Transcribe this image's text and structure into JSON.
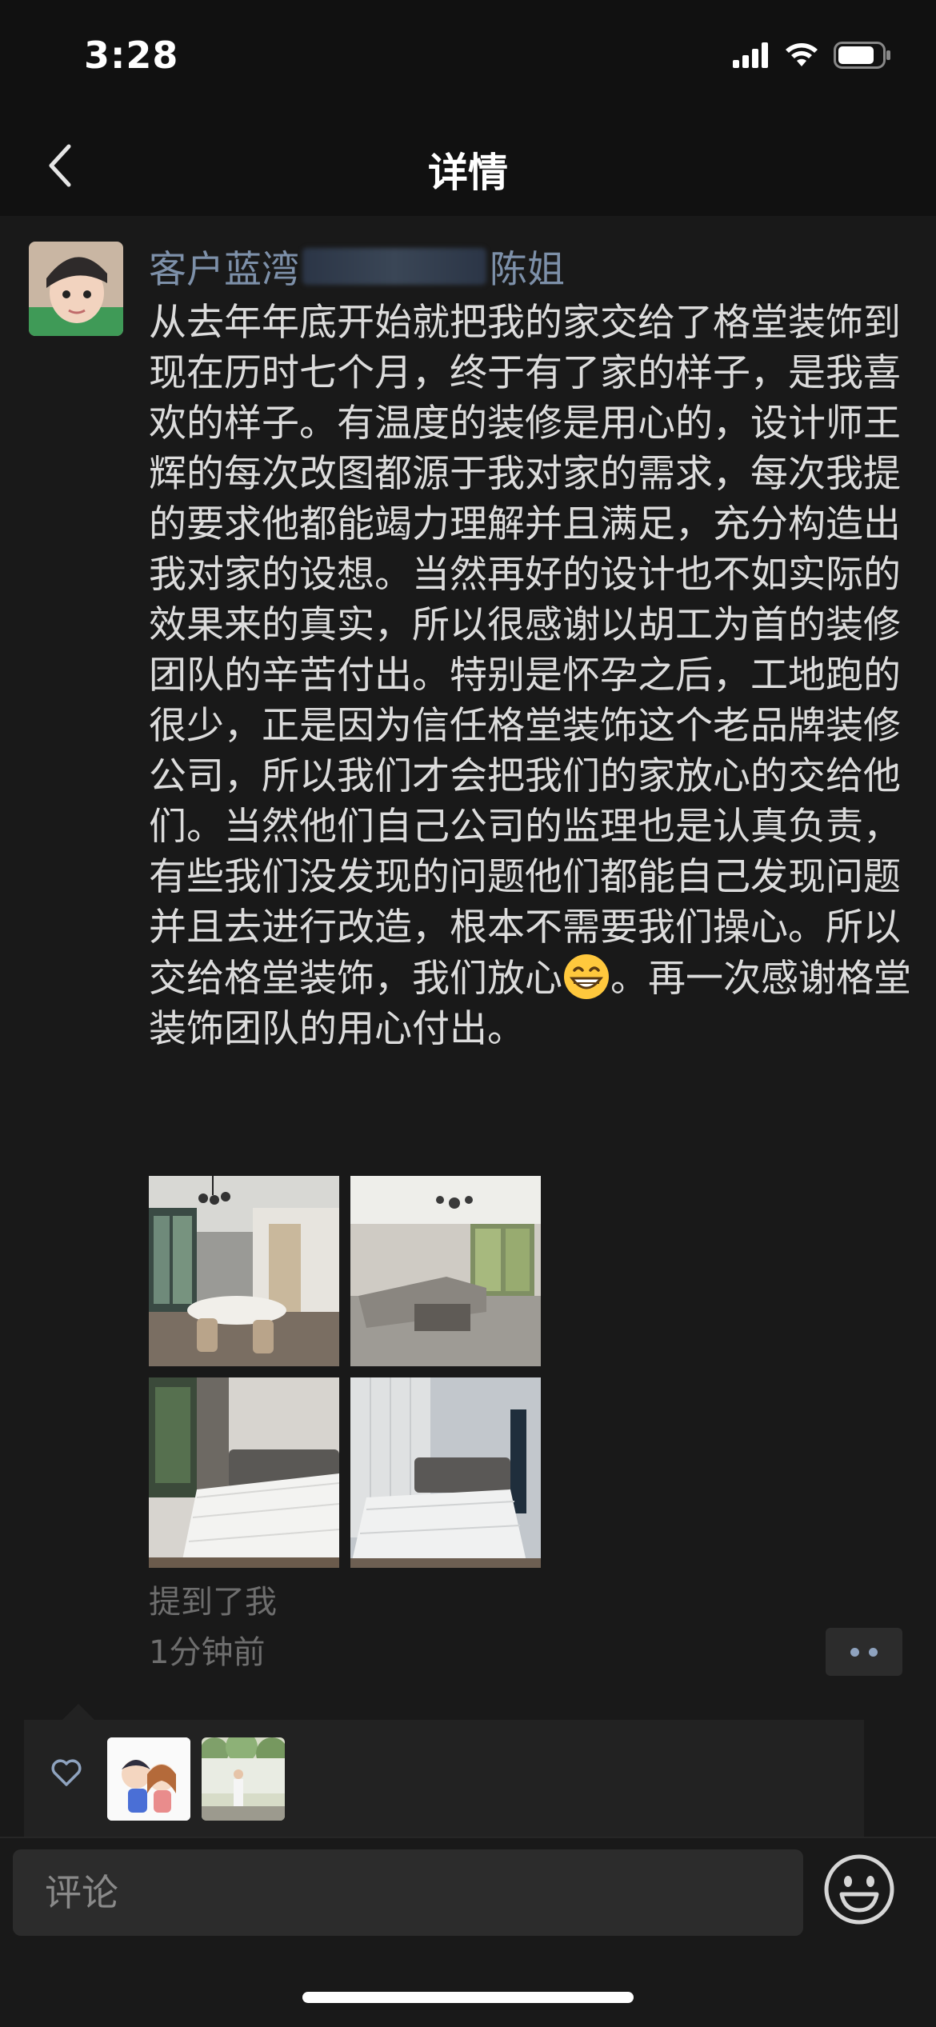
{
  "status_bar": {
    "time": "3:28"
  },
  "nav": {
    "title": "详情"
  },
  "post": {
    "author_prefix": "客户蓝湾",
    "author_suffix": "陈姐",
    "text_before_emoji": "从去年年底开始就把我的家交给了格堂装饰到现在历时七个月，终于有了家的样子，是我喜欢的样子。有温度的装修是用心的，设计师王辉的每次改图都源于我对家的需求，每次我提的要求他都能竭力理解并且满足，充分构造出我对家的设想。当然再好的设计也不如实际的效果来的真实，所以很感谢以胡工为首的装修团队的辛苦付出。特别是怀孕之后，工地跑的很少，正是因为信任格堂装饰这个老品牌装修公司，所以我们才会把我们的家放心的交给他们。当然他们自己公司的监理也是认真负责，有些我们没发现的问题他们都能自己发现问题并且去进行改造，根本不需要我们操心。所以交给格堂装饰，我们放心",
    "text_after_emoji": "。再一次感谢格堂装饰团队的用心付出。",
    "mention_label": "提到了我",
    "time_ago": "1分钟前"
  },
  "composer": {
    "placeholder": "评论"
  },
  "icons": {
    "back": "chevron-left-icon",
    "signal": "cellular-signal-icon",
    "wifi": "wifi-icon",
    "battery": "battery-icon",
    "emoji_in_text": "grinning-face-icon",
    "more": "more-dots-icon",
    "like": "heart-outline-icon",
    "emoji_button": "smiley-icon"
  },
  "colors": {
    "background": "#191919",
    "nav_background": "#111111",
    "author_name": "#7d90a9",
    "body_text": "#dcdcdc",
    "meta_text": "#6e6e6e"
  }
}
